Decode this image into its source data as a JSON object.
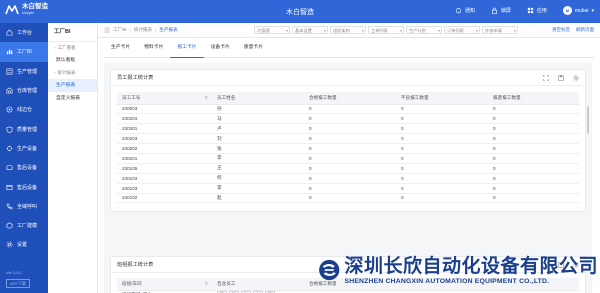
{
  "header": {
    "logo_name": "木白智造",
    "logo_sub": "Mubytie",
    "app_title": "木白智造",
    "actions": [
      {
        "label": "通知",
        "icon": "bell-icon"
      },
      {
        "label": "锁屏",
        "icon": "lock-icon"
      },
      {
        "label": "应用",
        "icon": "apps-icon"
      }
    ],
    "user": {
      "name": "mubai",
      "avatar_text": "M"
    }
  },
  "sidebar": {
    "items": [
      {
        "label": "工作台",
        "icon": "home-icon"
      },
      {
        "label": "工厂BI",
        "icon": "bi-icon"
      },
      {
        "label": "生产管理",
        "icon": "production-icon"
      },
      {
        "label": "仓库管理",
        "icon": "warehouse-icon"
      },
      {
        "label": "线边仓",
        "icon": "lineside-icon"
      },
      {
        "label": "质量管理",
        "icon": "quality-icon"
      },
      {
        "label": "生产设备",
        "icon": "equipment-icon"
      },
      {
        "label": "售后设备",
        "icon": "aftersales-icon"
      },
      {
        "label": "售后设备",
        "icon": "aftersales2-icon"
      },
      {
        "label": "全域呼叫",
        "icon": "call-icon"
      },
      {
        "label": "工厂建模",
        "icon": "modeling-icon"
      },
      {
        "label": "设置",
        "icon": "settings-icon"
      }
    ],
    "active_index": 1,
    "version": "Ver 3.8.1",
    "app_download": "APP下载"
  },
  "subnav": {
    "title": "工厂BI",
    "groups": [
      {
        "label": "工厂看板",
        "items": [
          "默认看板"
        ]
      },
      {
        "label": "统计报表",
        "items": [
          "生产报表",
          "自定义报表"
        ]
      }
    ],
    "active_item": "生产报表"
  },
  "crumbbar": {
    "crumbs": [
      "工厂BI",
      "统计报表",
      "生产报表"
    ],
    "filters": [
      "次管理",
      "基本设置",
      "组织架构",
      "工单列表",
      "生产计划",
      "订单列表",
      "外协申请"
    ],
    "right_links": [
      "清空标签",
      "刷新页面"
    ]
  },
  "tabs": [
    "生产卡片",
    "物料卡片",
    "报工卡片",
    "设备卡片",
    "质量卡片"
  ],
  "active_tab": "报工卡片",
  "panel1": {
    "title": "员工报工统计表",
    "columns": [
      "员工工号",
      "员工姓名",
      "合格报工数量",
      "不良报工数量",
      "报废报工数量"
    ],
    "rows": [
      [
        "230003",
        "孙",
        "0",
        "0",
        "0"
      ],
      [
        "230204",
        "马",
        "0",
        "0",
        "0"
      ],
      [
        "230301",
        "卢",
        "0",
        "0",
        "0"
      ],
      [
        "230203",
        "刘",
        "0",
        "0",
        "0"
      ],
      [
        "230202",
        "张",
        "0",
        "0",
        "0"
      ],
      [
        "230201",
        "李",
        "0",
        "0",
        "0"
      ],
      [
        "230105",
        "王",
        "0",
        "0",
        "0"
      ],
      [
        "230104",
        "何",
        "0",
        "0",
        "0"
      ],
      [
        "230103",
        "李",
        "0",
        "0",
        "0"
      ],
      [
        "230102",
        "赵",
        "0",
        "0",
        "0"
      ]
    ]
  },
  "panel2": {
    "title": "班组报工统计表",
    "columns": [
      "班组/车间",
      "包含员工",
      "合格报工数量"
    ],
    "rows": [
      {
        "group": "请组车间1工人",
        "members": [
          "罗",
          "孙",
          "李",
          "何",
          "王"
        ]
      }
    ]
  },
  "watermark": {
    "cn": "深圳长欣自动化设备有限公司",
    "en": "SHENZHEN CHANGXIN AUTOMATION EQUIPMENT CO.,LTD."
  },
  "colors": {
    "primary": "#2f67d8",
    "sidebar": "#1f4fb8",
    "sidebar_active": "#3b78ea"
  }
}
